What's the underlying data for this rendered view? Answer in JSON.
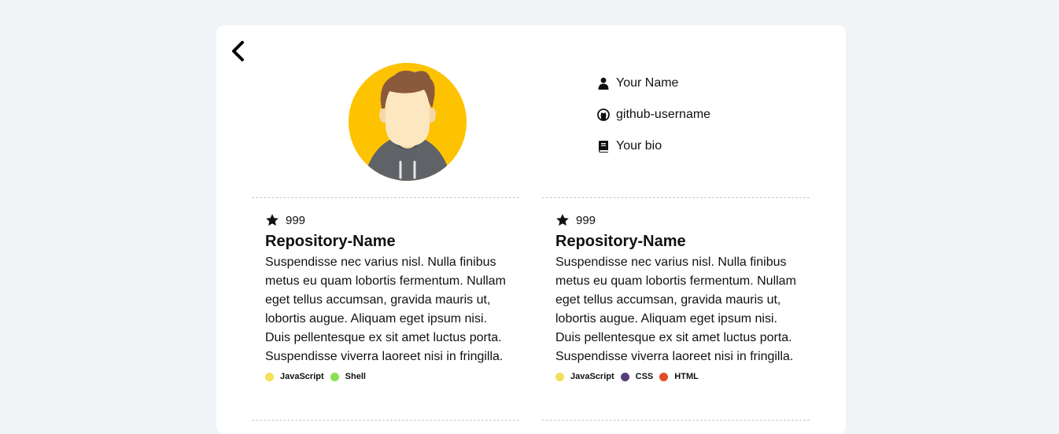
{
  "profile": {
    "name": "Your Name",
    "username": "github-username",
    "bio": "Your bio"
  },
  "repos": [
    {
      "stars": "999",
      "name": "Repository-Name",
      "description": "Suspendisse nec varius nisl. Nulla finibus metus eu quam lobortis fermentum. Nullam eget tellus accumsan, gravida mauris ut, lobortis augue. Aliquam eget ipsum nisi. Duis pellentesque ex sit amet luctus porta. Suspendisse viverra laoreet nisi in fringilla.",
      "languages": [
        {
          "name": "JavaScript",
          "color": "#f1e05a"
        },
        {
          "name": "Shell",
          "color": "#89e051"
        }
      ]
    },
    {
      "stars": "999",
      "name": "Repository-Name",
      "description": "Suspendisse nec varius nisl. Nulla finibus metus eu quam lobortis fermentum. Nullam eget tellus accumsan, gravida mauris ut, lobortis augue. Aliquam eget ipsum nisi. Duis pellentesque ex sit amet luctus porta. Suspendisse viverra laoreet nisi in fringilla.",
      "languages": [
        {
          "name": "JavaScript",
          "color": "#f1e05a"
        },
        {
          "name": "CSS",
          "color": "#563d7c"
        },
        {
          "name": "HTML",
          "color": "#e34c26"
        }
      ]
    }
  ],
  "icons": {
    "back": "chevron-left-icon",
    "name": "user-icon",
    "username": "github-icon",
    "bio": "book-icon",
    "stars": "star-icon"
  }
}
